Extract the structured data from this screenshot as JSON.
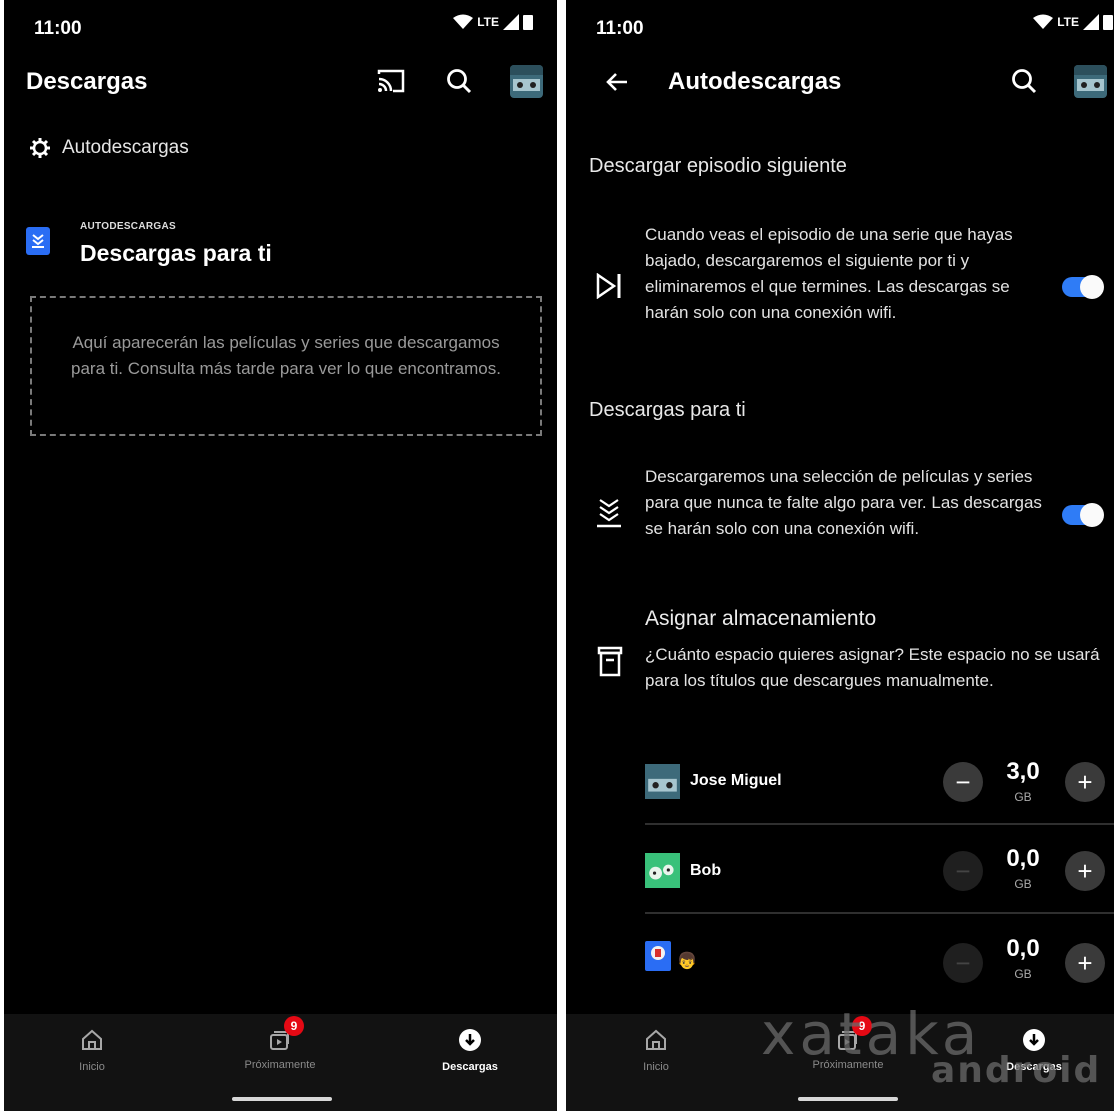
{
  "left": {
    "status": {
      "time": "11:00",
      "network": "LTE"
    },
    "appbar": {
      "title": "Descargas",
      "icons": [
        "cast-icon",
        "search-icon",
        "profile-avatar"
      ]
    },
    "autodownloads_link": {
      "label": "Autodescargas",
      "icon": "gear-icon"
    },
    "card": {
      "eyebrow": "AUTODESCARGAS",
      "title": "Descargas para ti",
      "icon": "download-for-you-icon"
    },
    "empty_message": "Aquí aparecerán las películas y series que descargamos para ti. Consulta más tarde para ver lo que encontramos.",
    "bottom_nav": [
      {
        "label": "Inicio",
        "icon": "home-icon"
      },
      {
        "label": "Próximamente",
        "icon": "coming-soon-icon",
        "badge": "9"
      },
      {
        "label": "Descargas",
        "icon": "downloads-icon"
      }
    ]
  },
  "right": {
    "status": {
      "time": "11:00",
      "network": "LTE"
    },
    "appbar": {
      "title": "Autodescargas",
      "icons": [
        "back-arrow-icon",
        "search-icon",
        "profile-avatar"
      ]
    },
    "section1": {
      "title": "Descargar episodio siguiente",
      "text": "Cuando veas el episodio de una serie que hayas bajado, descargaremos el siguiente por ti y eliminaremos el que termines. Las descargas se harán solo con una conexión wifi.",
      "toggle_on": true
    },
    "section2": {
      "title": "Descargas para ti",
      "text": "Descargaremos una selección de películas y series para que nunca te falte algo para ver. Las descargas se harán solo con una conexión wifi.",
      "toggle_on": true
    },
    "storage": {
      "title": "Asignar almacenamiento",
      "text": "¿Cuánto espacio quieres asignar? Este espacio no se usará para los títulos que descargues manualmente.",
      "profiles": [
        {
          "name": "Jose Miguel",
          "value": "3,0",
          "unit": "GB"
        },
        {
          "name": "Bob",
          "value": "0,0",
          "unit": "GB"
        },
        {
          "name": "",
          "value": "0,0",
          "unit": "GB"
        }
      ]
    },
    "bottom_nav": [
      {
        "label": "Inicio",
        "icon": "home-icon"
      },
      {
        "label": "Próximamente",
        "icon": "coming-soon-icon",
        "badge": "9"
      },
      {
        "label": "Descargas",
        "icon": "downloads-icon"
      }
    ],
    "watermark": {
      "top": "xataka",
      "bottom": "android"
    }
  },
  "colors": {
    "toggle": "#2f7cf6",
    "badge": "#e50914",
    "card_icon": "#2a6df4"
  }
}
